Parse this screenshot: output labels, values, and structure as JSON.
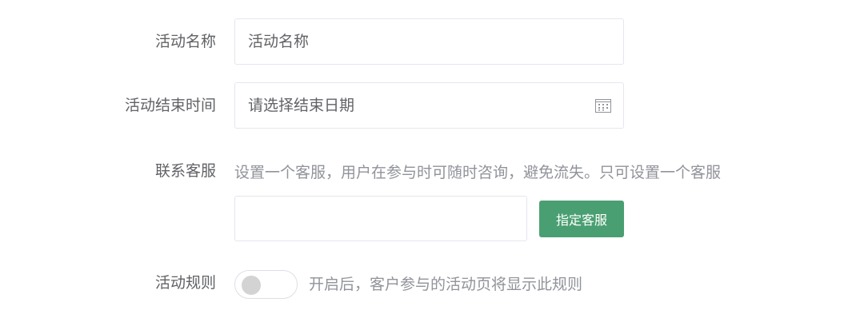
{
  "form": {
    "activity_name": {
      "label": "活动名称",
      "placeholder": "活动名称"
    },
    "end_time": {
      "label": "活动结束时间",
      "placeholder": "请选择结束日期",
      "icon": "calendar-icon"
    },
    "customer_service": {
      "label": "联系客服",
      "hint": "设置一个客服，用户在参与时可随时咨询，避免流失。只可设置一个客服",
      "input_value": "",
      "button_label": "指定客服"
    },
    "rules": {
      "label": "活动规则",
      "toggle_on": false,
      "hint": "开启后，客户参与的活动页将显示此规则"
    }
  },
  "colors": {
    "primary": "#4a9f72",
    "label": "#606266",
    "hint": "#909399",
    "border": "#e4e7ed"
  }
}
